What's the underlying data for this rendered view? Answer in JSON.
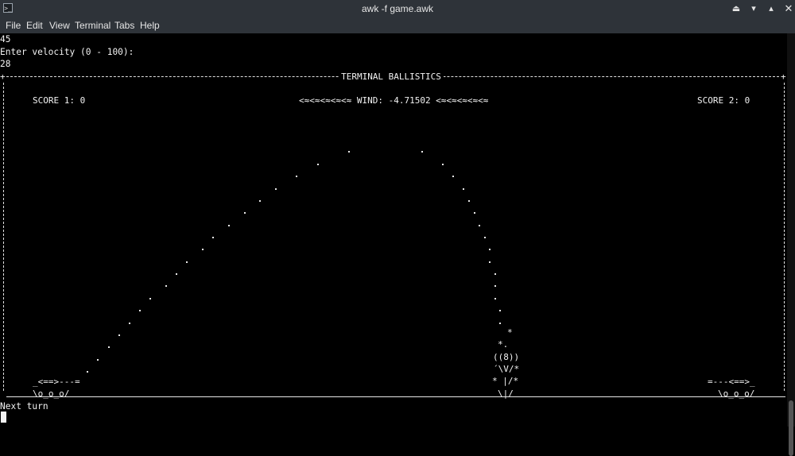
{
  "window": {
    "title": "awk -f game.awk",
    "icons": [
      "terminal-icon",
      "eject-icon",
      "minimize-icon",
      "maximize-icon",
      "close-icon"
    ]
  },
  "menu": {
    "items": [
      "File",
      "Edit",
      "View",
      "Terminal",
      "Tabs",
      "Help"
    ]
  },
  "terminal": {
    "prev_input": "45",
    "prompt": "Enter velocity (0 - 100):",
    "input_value": "28",
    "banner": "TERMINAL BALLISTICS",
    "score1": "SCORE 1: 0",
    "score2": "SCORE 2: 0",
    "wind": "<≈<≈<≈<≈<≈ WIND: -4.71502 <≈<≈<≈<≈<≈",
    "cannon_left": {
      "line1": "_<==>---=",
      "line2": "\\o_o_o/"
    },
    "cannon_right": {
      "line1": "=---<==>_",
      "line2": "\\o_o_o/"
    },
    "explosion": {
      "line1": "*",
      "line2": "*.",
      "line3": "((8))",
      "line4": "´\\V/*",
      "line5": "* |/*",
      "line6": "\\|/"
    },
    "status": "Next turn"
  },
  "colors": {
    "background": "#000000",
    "foreground": "#f2f2f2",
    "titlebar": "#2e3339"
  }
}
